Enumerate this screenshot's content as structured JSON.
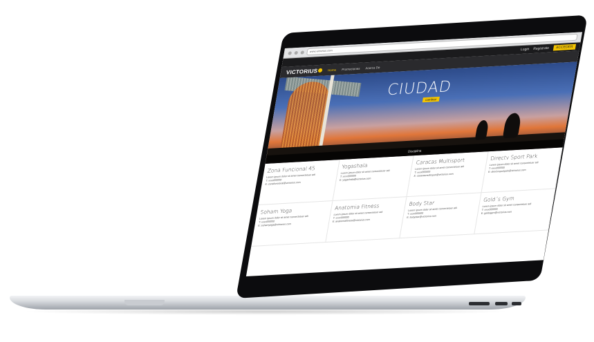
{
  "browser": {
    "url": "www.victorius.com"
  },
  "site_header": {
    "login_label": "Login",
    "register_label": "Registrate",
    "cta_label": "ACCEDER"
  },
  "nav": {
    "logo": "VICTORIUS",
    "items": [
      {
        "label": "Home",
        "active": true
      },
      {
        "label": "Promociones",
        "active": false
      },
      {
        "label": "Acerca De",
        "active": false
      }
    ]
  },
  "hero": {
    "title": "CIUDAD",
    "pill": "cambiar",
    "caption": "Disciplina"
  },
  "listings": [
    {
      "name": "Zona Funcional 45",
      "desc": "Lorem ipsum dolor sit amet consectetuer adi",
      "phone": "T: xxxx000000",
      "email": "E: zonafuncional@victorius.com"
    },
    {
      "name": "Yogashala",
      "desc": "Lorem ipsum dolor sit amet consectetuer adi",
      "phone": "T: xxxx000000",
      "email": "E: yogashala@victorius.com"
    },
    {
      "name": "Caracas Multisport",
      "desc": "Lorem ipsum dolor sit amet consectetuer adi",
      "phone": "T: xxxx000000",
      "email": "E: caracasmultisport@victorius.com"
    },
    {
      "name": "Directv Sport Park",
      "desc": "Lorem ipsum dolor sit amet consectetuer adi",
      "phone": "T: xxxx000000",
      "email": "E: directvsportpark@victorius.com"
    },
    {
      "name": "Soham Yoga",
      "desc": "Lorem ipsum dolor sit amet consectetuer adi",
      "phone": "T: xxxx000000",
      "email": "E: sohamyoga@victorius.com"
    },
    {
      "name": "Anatomia Fitness",
      "desc": "Lorem ipsum dolor sit amet consectetuer adi",
      "phone": "T: xxxx000000",
      "email": "E: anatomiafitness@victorius.com"
    },
    {
      "name": "Body Star",
      "desc": "Lorem ipsum dolor sit amet consectetuer adi",
      "phone": "T: xxxx000000",
      "email": "E: bodystar@victorius.com"
    },
    {
      "name": "Gold´s Gym",
      "desc": "Lorem ipsum dolor sit amet consectetuer adi",
      "phone": "T: xxxx000000",
      "email": "E: goldsgym@victorius.com"
    }
  ]
}
